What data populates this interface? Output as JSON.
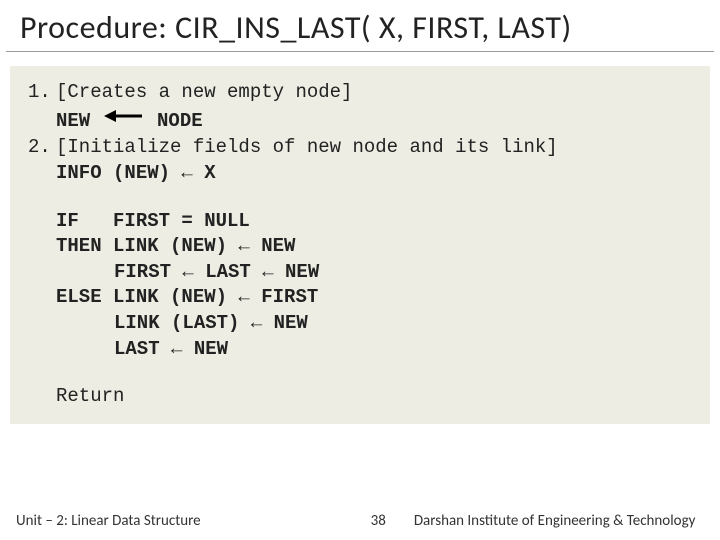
{
  "title": "Procedure: CIR_INS_LAST( X, FIRST, LAST)",
  "steps": {
    "s1_num": "1.",
    "s1_desc": "[Creates a new empty node]",
    "s1_code_left": "NEW ",
    "s1_code_right": " NODE",
    "s2_num": "2.",
    "s2_desc": "[Initialize fields of new node and its link]",
    "s2_code": "INFO (NEW) ← X",
    "if_line": "IF   FIRST = NULL",
    "then_line": "THEN LINK (NEW) ← NEW",
    "then2": "FIRST ← LAST ← NEW",
    "else_line": "ELSE LINK (NEW) ← FIRST",
    "else2": "LINK (LAST) ← NEW",
    "else3": "LAST ← NEW",
    "return": "Return"
  },
  "footer": {
    "left": "Unit – 2: Linear Data Structure",
    "page": "38",
    "right": "Darshan Institute of Engineering & Technology"
  },
  "icons": {
    "left_arrow": "left-arrow-icon"
  }
}
